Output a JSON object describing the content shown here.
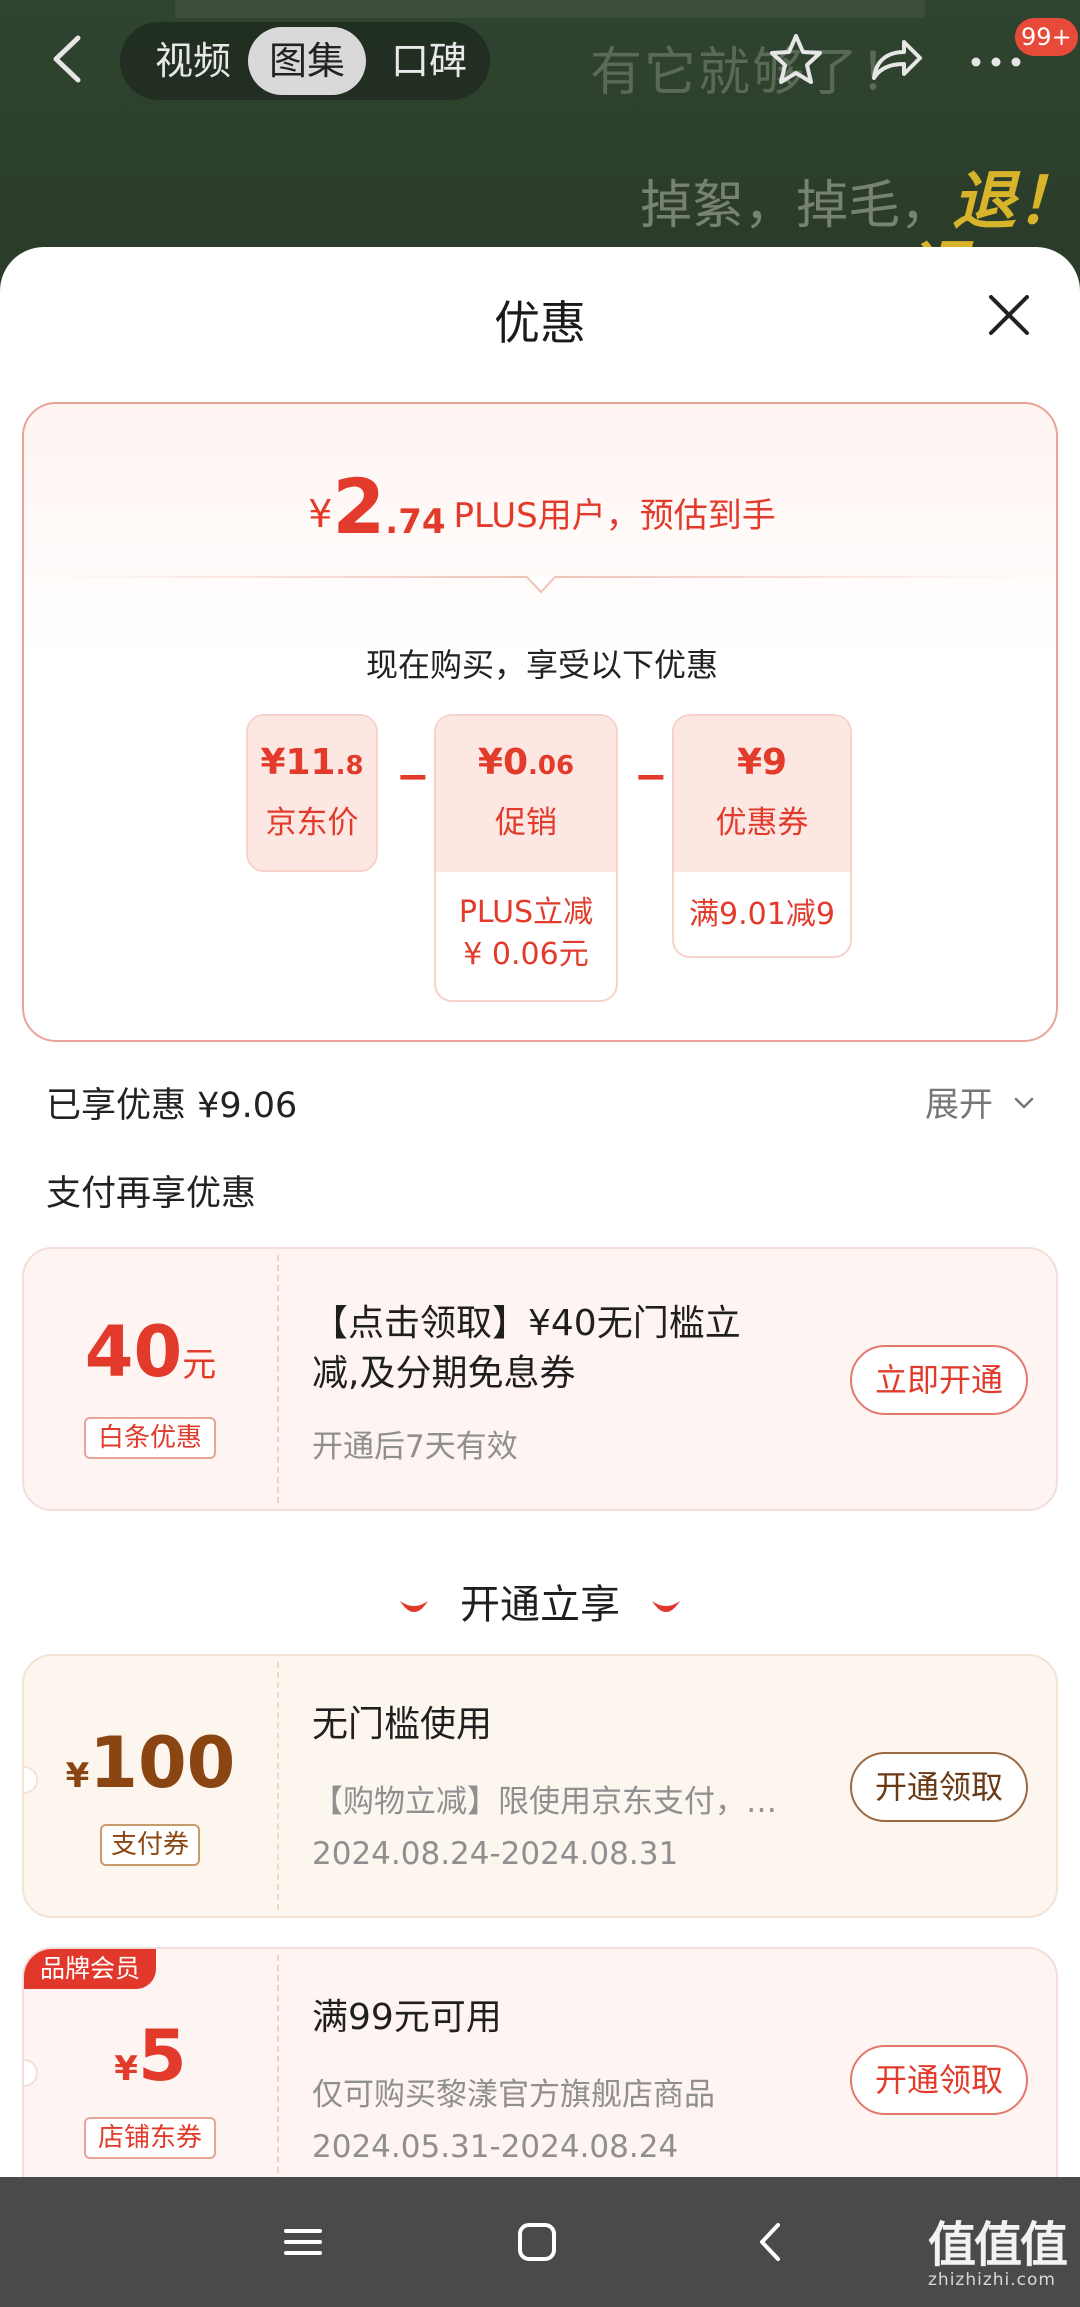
{
  "background": {
    "slogan_line1": "有它就够了！",
    "slogan_line2": "掉絮，掉毛，",
    "slogan_line2_highlight": "退！",
    "slogan_line3": "退"
  },
  "topbar": {
    "tabs": [
      {
        "label": "视频",
        "active": false
      },
      {
        "label": "图集",
        "active": true
      },
      {
        "label": "口碑",
        "active": false
      }
    ],
    "badge": "99+"
  },
  "sheet": {
    "title": "优惠",
    "price_card": {
      "currency": "¥",
      "price_int": "2",
      "price_dec": ".74",
      "price_desc": "PLUS用户，预估到手",
      "subtitle": "现在购买，享受以下优惠",
      "items": [
        {
          "amount_main": "¥11",
          "amount_small": ".8",
          "label": "京东价",
          "detail": ""
        },
        {
          "amount_main": "¥0",
          "amount_small": ".06",
          "label": "促销",
          "detail_line1": "PLUS立减",
          "detail_line2": "¥ 0.06元"
        },
        {
          "amount_main": "¥9",
          "amount_small": "",
          "label": "优惠券",
          "detail_line1": "满9.01减9"
        }
      ],
      "operator": "−"
    },
    "enjoyed_text": "已享优惠 ¥9.06",
    "expand_label": "展开",
    "pay_title": "支付再享优惠",
    "baitiao": {
      "amount": "40",
      "unit": "元",
      "tag": "白条优惠",
      "title_line1": "【点击领取】¥40无门槛立",
      "title_line2": "减,及分期免息券",
      "desc": "开通后7天有效",
      "button": "立即开通"
    },
    "open_header": "开通立享",
    "coupons": [
      {
        "currency": "¥",
        "amount": "100",
        "tag": "支付券",
        "title": "无门槛使用",
        "desc": "【购物立减】限使用京东支付，…",
        "date": "2024.08.24-2024.08.31",
        "button": "开通领取"
      },
      {
        "corner": "品牌会员",
        "currency": "¥",
        "amount": "5",
        "tag": "店铺东券",
        "title": "满99元可用",
        "desc": "仅可购买黎漾官方旗舰店商品",
        "date": "2024.05.31-2024.08.24",
        "button": "开通领取"
      }
    ]
  },
  "watermark": {
    "main": "值值值",
    "sub": "zhizhizhi.com"
  },
  "colors": {
    "accent": "#e23b2b",
    "gold": "#8b4512",
    "navbar": "#4a4a4a"
  }
}
